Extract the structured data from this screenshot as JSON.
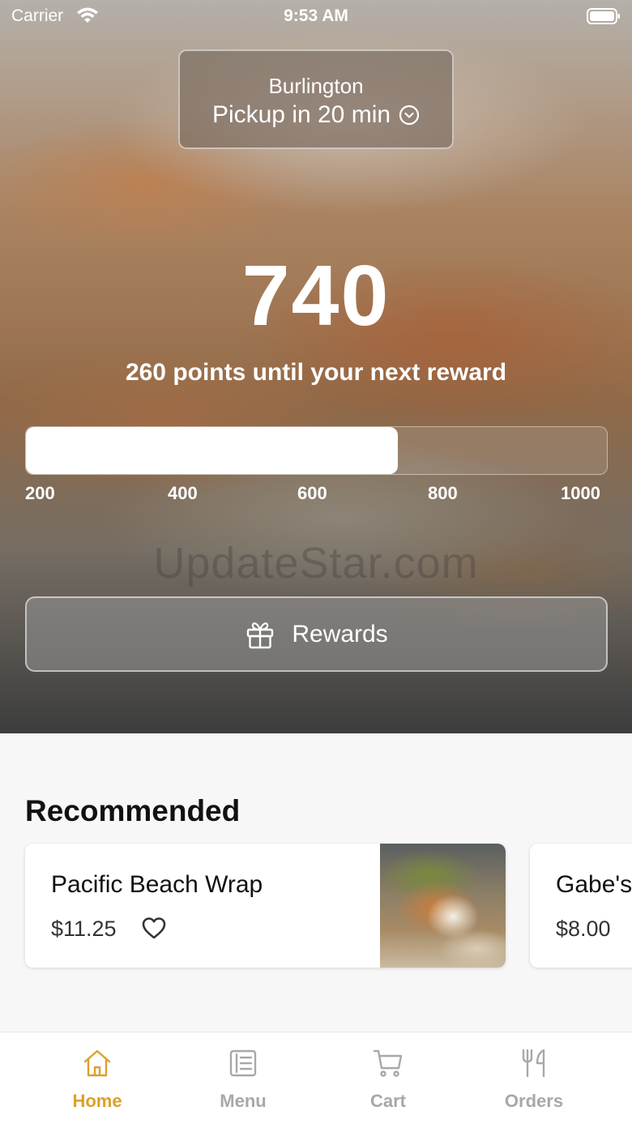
{
  "status_bar": {
    "carrier": "Carrier",
    "time": "9:53 AM"
  },
  "location": {
    "name": "Burlington",
    "pickup": "Pickup in 20 min"
  },
  "rewards": {
    "points": "740",
    "subtitle": "260 points until your next reward",
    "progress_fraction": 0.64,
    "ticks": [
      "200",
      "400",
      "600",
      "800",
      "1000"
    ],
    "button_label": "Rewards"
  },
  "watermark": "UpdateStar.com",
  "recommended": {
    "title": "Recommended",
    "items": [
      {
        "name": "Pacific Beach Wrap",
        "price": "$11.25"
      },
      {
        "name": "Gabe's",
        "price": "$8.00"
      }
    ]
  },
  "tab_bar": {
    "active_color": "#dca02a",
    "inactive_color": "#a8a8a8",
    "tabs": [
      {
        "label": "Home",
        "icon": "home-icon",
        "active": true
      },
      {
        "label": "Menu",
        "icon": "menu-icon",
        "active": false
      },
      {
        "label": "Cart",
        "icon": "cart-icon",
        "active": false
      },
      {
        "label": "Orders",
        "icon": "utensils-icon",
        "active": false
      }
    ]
  }
}
